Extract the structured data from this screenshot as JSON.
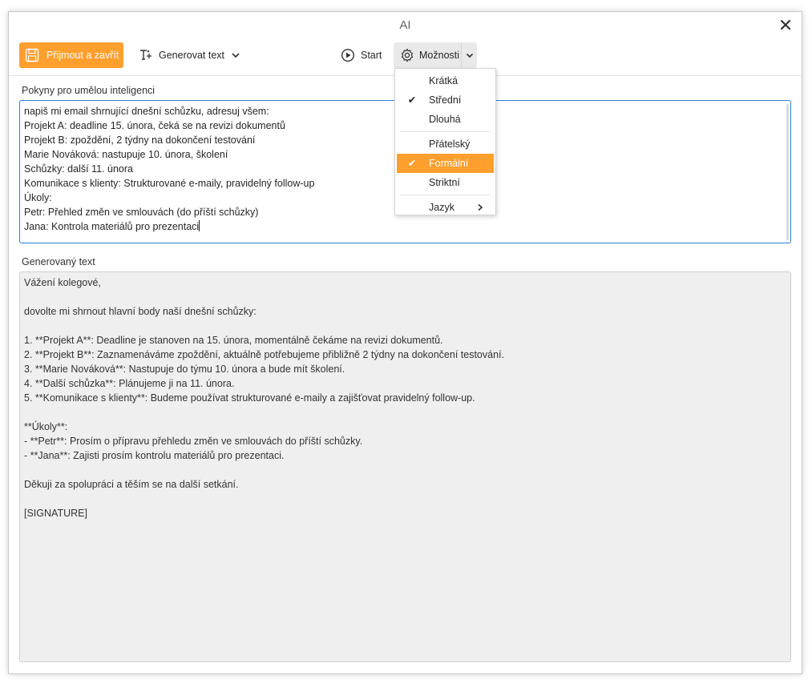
{
  "window": {
    "title": "AI"
  },
  "toolbar": {
    "accept_label": "Přijmout a zavřít",
    "generate_label": "Generovat text",
    "start_label": "Start",
    "options_label": "Možnosti"
  },
  "prompt": {
    "label": "Pokyny pro umělou inteligenci",
    "lines": [
      "napiš mi email shrnující dnešní schůzku, adresuj všem:",
      "Projekt A: deadline 15. února, čeká se na revizi dokumentů",
      "Projekt B: zpoždění, 2 týdny na dokončení testování",
      "Marie Nováková: nastupuje 10. února, školení",
      "Schůzky: další 11. února",
      "Komunikace s klienty: Strukturované e-maily, pravidelný follow-up",
      "Úkoly:",
      "Petr: Přehled změn ve smlouvách (do příští schůzky)",
      "Jana: Kontrola materiálů pro prezentaci"
    ]
  },
  "output": {
    "label": "Generovaný text",
    "lines": [
      "Vážení kolegové,",
      "",
      "dovolte mi shrnout hlavní body naší dnešní schůzky:",
      "",
      "1. **Projekt A**: Deadline je stanoven na 15. února, momentálně čekáme na revizi dokumentů.",
      "2. **Projekt B**: Zaznamenáváme zpoždění, aktuálně potřebujeme přibližně 2 týdny na dokončení testování.",
      "3. **Marie Nováková**: Nastupuje do týmu 10. února a bude mít školení.",
      "4. **Další schůzka**: Plánujeme ji na 11. února.",
      "5. **Komunikace s klienty**: Budeme používat strukturované e-maily a zajišťovat pravidelný follow-up.",
      "",
      "**Úkoly**:",
      "- **Petr**: Prosím o přípravu přehledu změn ve smlouvách do příští schůzky.",
      "- **Jana**: Zajisti prosím kontrolu materiálů pro prezentaci.",
      "",
      "Děkuji za spolupráci a těším se na další setkání.",
      "",
      "[SIGNATURE]"
    ]
  },
  "options_menu": {
    "length_items": [
      {
        "label": "Krátká",
        "checked": false
      },
      {
        "label": "Střední",
        "checked": true
      },
      {
        "label": "Dlouhá",
        "checked": false
      }
    ],
    "tone_items": [
      {
        "label": "Přátelský",
        "checked": false
      },
      {
        "label": "Formální",
        "checked": true,
        "highlighted": true
      },
      {
        "label": "Striktní",
        "checked": false
      }
    ],
    "language_label": "Jazyk"
  },
  "colors": {
    "accent": "#ff9f2e",
    "focus_border": "#2b7fd6",
    "output_bg": "#efefef"
  },
  "icons": {
    "accept": "save-icon",
    "generate": "text-sparkle-icon",
    "start": "play-circle-icon",
    "options": "gear-icon",
    "close": "close-icon"
  }
}
